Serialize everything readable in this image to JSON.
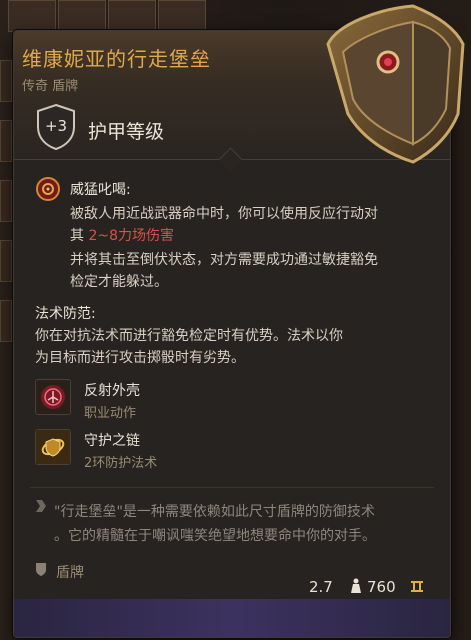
{
  "item": {
    "name": "维康妮亚的行走堡垒",
    "rarity_type": "传奇 盾牌",
    "ac_bonus": "+3",
    "ac_label": "护甲等级"
  },
  "abilities": {
    "intimidate_title": "威猛叱喝:",
    "intimidate_line1": "被敌人用近战武器命中时，你可以使用反应行动对",
    "intimidate_line2_prefix": "其",
    "intimidate_damage": "2~8力场伤害",
    "intimidate_line3": "并将其击至倒伏状态，对方需要成功通过敏捷豁免",
    "intimidate_line4": "检定才能躲过。",
    "spell_guard_title": "法术防范:",
    "spell_guard_line1": "你在对抗法术而进行豁免检定时有优势。法术以你",
    "spell_guard_line2": "为目标而进行攻击掷骰时有劣势。"
  },
  "granted": [
    {
      "name": "反射外壳",
      "type": "职业动作",
      "icon": "reflect-rune-icon"
    },
    {
      "name": "守护之链",
      "type": "2环防护法术",
      "icon": "warding-bond-icon"
    }
  ],
  "flavor": {
    "line1": "\"行走堡垒\"是一种需要依赖如此尺寸盾牌的防御技术",
    "line2": "。它的精髓在于嘲讽嗤笑绝望地想要命中你的对手。"
  },
  "category": "盾牌",
  "footer": {
    "weight": "2.7",
    "price": "760"
  },
  "colors": {
    "title": "#e0a94a",
    "damage": "#d9514a",
    "footer": "#3c3260"
  }
}
